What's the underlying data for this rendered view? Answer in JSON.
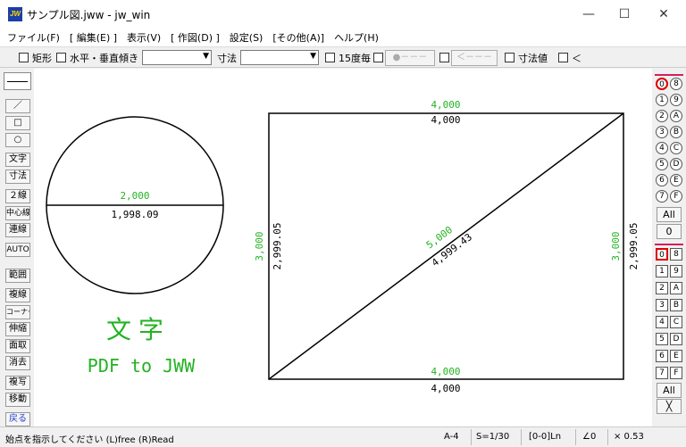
{
  "window": {
    "icon_text": "JW",
    "title": "サンプル図.jww - jw_win",
    "minimize": "—",
    "maximize": "☐",
    "close": "✕"
  },
  "menu": [
    "ファイル(F)",
    "[ 編集(E) ]",
    "表示(V)",
    "[ 作図(D) ]",
    "設定(S)",
    "[その他(A)]",
    "ヘルプ(H)"
  ],
  "toolbar": {
    "rect_label": "矩形",
    "hv_label": "水平・垂直",
    "slope_label": "傾き",
    "dim_label": "寸法",
    "deg15_label": "15度毎",
    "btn1": "●－－－",
    "btn2": "＜－－－",
    "dimval_label": "寸法値",
    "lt_label": "＜"
  },
  "left_tools": [
    "／",
    "□",
    "○",
    "文字",
    "寸法",
    "２線",
    "中心線",
    "連線",
    "AUTO",
    "範囲",
    "複線",
    "コーナー",
    "伸縮",
    "面取",
    "消去",
    "複写",
    "移動",
    "戻る"
  ],
  "drawing": {
    "circle_dim_green": "2,000",
    "circle_dim_black": "1,998.09",
    "text_big": "文字",
    "text_sub": "PDF to JWW",
    "top_green": "4,000",
    "top_black": "4,000",
    "bottom_green": "4,000",
    "bottom_black": "4,000",
    "left_green": "3,000",
    "left_black": "2,999.05",
    "right_green": "3,000",
    "right_black": "2,999.05",
    "diag_green": "5,000",
    "diag_black": "4,999.43",
    "colors": {
      "green": "#22b322",
      "black": "#000000"
    }
  },
  "layer_groups": {
    "circles": [
      "0",
      "8",
      "1",
      "9",
      "2",
      "A",
      "3",
      "B",
      "4",
      "C",
      "5",
      "D",
      "6",
      "E",
      "7",
      "F"
    ],
    "all_label": "All",
    "zero_label": "0",
    "squares": [
      "0",
      "8",
      "1",
      "9",
      "2",
      "A",
      "3",
      "B",
      "4",
      "C",
      "5",
      "D",
      "6",
      "E",
      "7",
      "F"
    ],
    "all2_label": "All",
    "x_label": "╳"
  },
  "status": {
    "message": "始点を指示してください  (L)free  (R)Read",
    "paper": "A-4",
    "scale": "S=1/30",
    "layer": "[0-0]Ln",
    "angle": "∠0",
    "zoom": "× 0.53"
  }
}
